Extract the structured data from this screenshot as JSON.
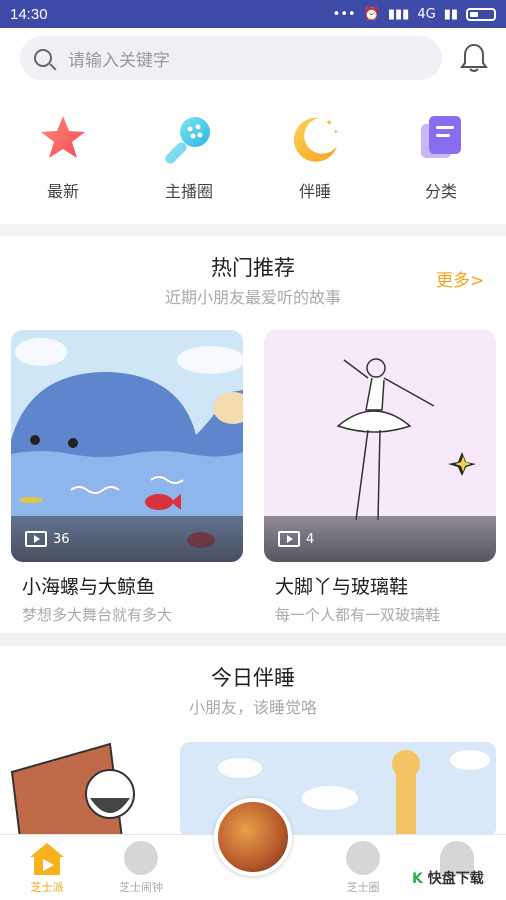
{
  "status_bar": {
    "time": "14:30",
    "network": "4G"
  },
  "search": {
    "placeholder": "请输入关键字"
  },
  "categories": [
    {
      "label": "最新",
      "icon": "star-icon"
    },
    {
      "label": "主播圈",
      "icon": "microphone-icon"
    },
    {
      "label": "伴睡",
      "icon": "moon-icon"
    },
    {
      "label": "分类",
      "icon": "category-card-icon"
    }
  ],
  "hot": {
    "title": "热门推荐",
    "subtitle": "近期小朋友最爱听的故事",
    "more": "更多>",
    "cards": [
      {
        "title": "小海螺与大鲸鱼",
        "subtitle": "梦想多大舞台就有多大",
        "count": "36"
      },
      {
        "title": "大脚丫与玻璃鞋",
        "subtitle": "每一个人都有一双玻璃鞋",
        "count": "4"
      }
    ]
  },
  "tonight": {
    "title": "今日伴睡",
    "subtitle": "小朋友，该睡觉咯"
  },
  "nav": {
    "items": [
      {
        "label": "芝士派",
        "active": true
      },
      {
        "label": "芝士闹钟",
        "active": false
      },
      {
        "label": "芝士圈",
        "active": false
      },
      {
        "label": "",
        "active": false
      }
    ]
  },
  "watermark": {
    "text": "快盘下载"
  },
  "colors": {
    "status_bar": "#3d4aa8",
    "accent": "#f1a51a"
  }
}
